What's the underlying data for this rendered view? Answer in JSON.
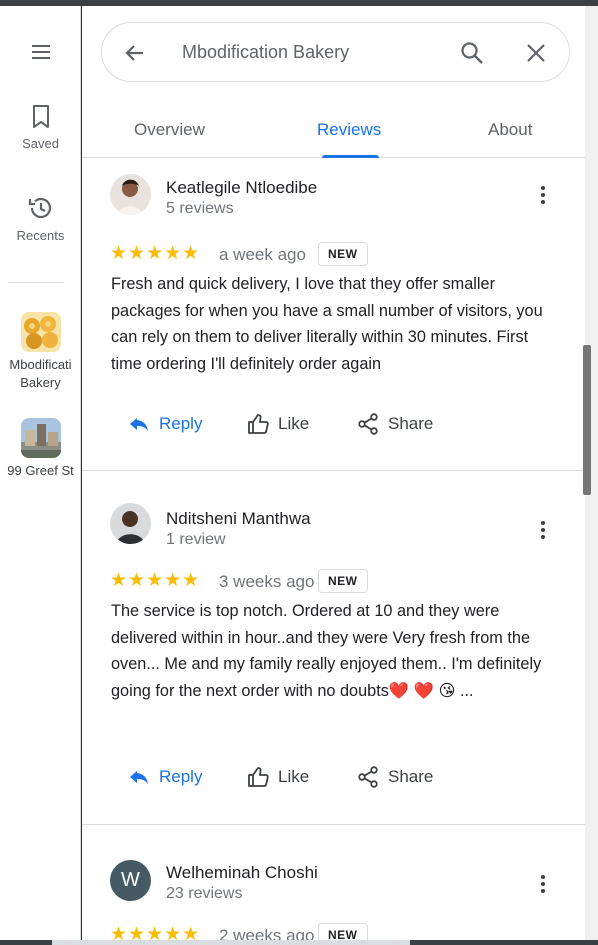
{
  "colors": {
    "accent": "#1a73e8",
    "star": "#fbbc04",
    "muted": "#70757a",
    "divider": "#dadce0"
  },
  "rail": {
    "menu_icon": "hamburger-menu-icon",
    "saved_label": "Saved",
    "recents_label": "Recents",
    "places": [
      {
        "label_line1": "Mbodificati",
        "label_line2": "Bakery"
      },
      {
        "label_line1": "99 Greef St",
        "label_line2": ""
      }
    ]
  },
  "search": {
    "query": "Mbodification Bakery"
  },
  "tabs": [
    {
      "label": "Overview",
      "active": false
    },
    {
      "label": "Reviews",
      "active": true
    },
    {
      "label": "About",
      "active": false
    }
  ],
  "reviews": [
    {
      "author": "Keatlegile Ntloedibe",
      "review_count": "5 reviews",
      "stars": "★★★★★",
      "rating": 5,
      "when": "a week ago",
      "badge": "NEW",
      "text": "Fresh and quick delivery, I love that they offer smaller packages for when you have a small number of visitors, you can rely on them to deliver literally within 30 minutes. First time ordering I'll definitely order again",
      "actions": {
        "reply": "Reply",
        "like": "Like",
        "share": "Share"
      }
    },
    {
      "author": "Nditsheni Manthwa",
      "review_count": "1 review",
      "stars": "★★★★★",
      "rating": 5,
      "when": "3 weeks ago",
      "badge": "NEW",
      "text": "The service is top notch. Ordered at 10 and they were delivered within in hour..and they were Very fresh from the oven... Me and my family really enjoyed them.. I'm definitely going for the next order with no doubts❤️ ❤️ 😘 ...",
      "actions": {
        "reply": "Reply",
        "like": "Like",
        "share": "Share"
      }
    },
    {
      "author": "Welheminah Choshi",
      "avatar_letter": "W",
      "review_count": "23 reviews",
      "stars": "★★★★★",
      "rating": 5,
      "when": "2 weeks ago",
      "badge": "NEW"
    }
  ]
}
